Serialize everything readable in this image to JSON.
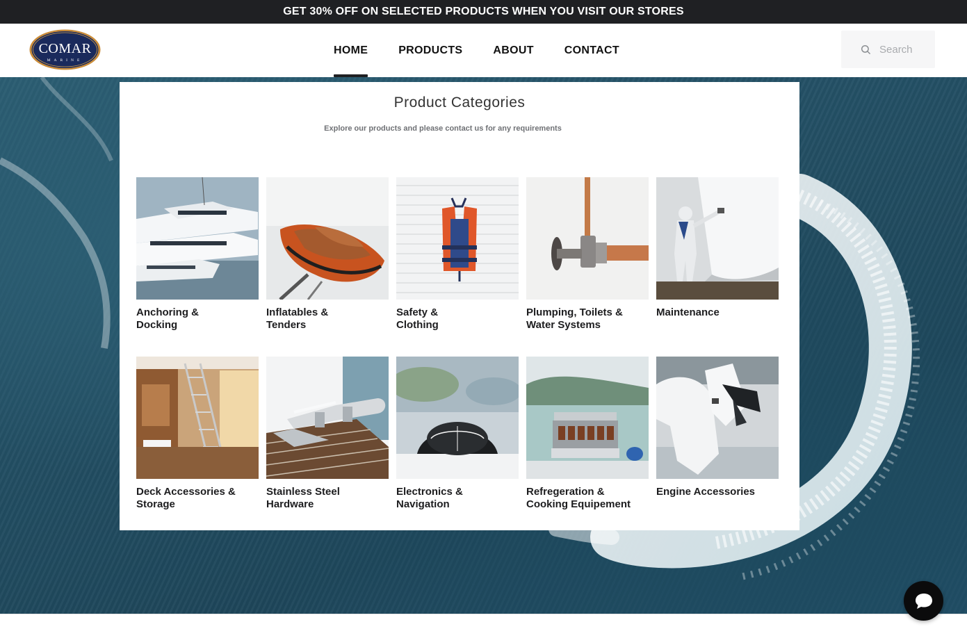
{
  "promo": {
    "text": "GET 30% OFF ON SELECTED PRODUCTS WHEN YOU VISIT OUR STORES"
  },
  "logo": {
    "wordmark": "COMAR",
    "subtext": "MARINE"
  },
  "nav": {
    "items": [
      {
        "label": "HOME",
        "active": true
      },
      {
        "label": "PRODUCTS",
        "active": false
      },
      {
        "label": "ABOUT",
        "active": false
      },
      {
        "label": "CONTACT",
        "active": false
      }
    ]
  },
  "search": {
    "placeholder": "Search",
    "icon": "search-icon"
  },
  "categories": {
    "title": "Product Categories",
    "subtitle": "Explore our products and please contact us for any requirements",
    "items": [
      {
        "label": "Anchoring &\nDocking",
        "image": "yachts-marina"
      },
      {
        "label": "Inflatables &\nTenders",
        "image": "orange-inflatable-boat"
      },
      {
        "label": "Safety &\nClothing",
        "image": "life-jacket"
      },
      {
        "label": "Plumping, Toilets &\nWater Systems",
        "image": "copper-valve"
      },
      {
        "label": "Maintenance",
        "image": "hull-painting"
      },
      {
        "label": "Deck Accessories &\nStorage",
        "image": "yacht-deck-ladder"
      },
      {
        "label": "Stainless Steel\nHardware",
        "image": "steel-cleat"
      },
      {
        "label": "Electronics &\nNavigation",
        "image": "compass"
      },
      {
        "label": "Refregeration &\nCooking Equipement",
        "image": "boat-grill"
      },
      {
        "label": "Engine Accessories",
        "image": "outboard-engine"
      }
    ]
  },
  "chat": {
    "icon": "chat-bubble-icon"
  },
  "colors": {
    "promo_bg": "#1f2023",
    "sea": "#2b5d72",
    "accent_dark": "#0b0b0c"
  }
}
